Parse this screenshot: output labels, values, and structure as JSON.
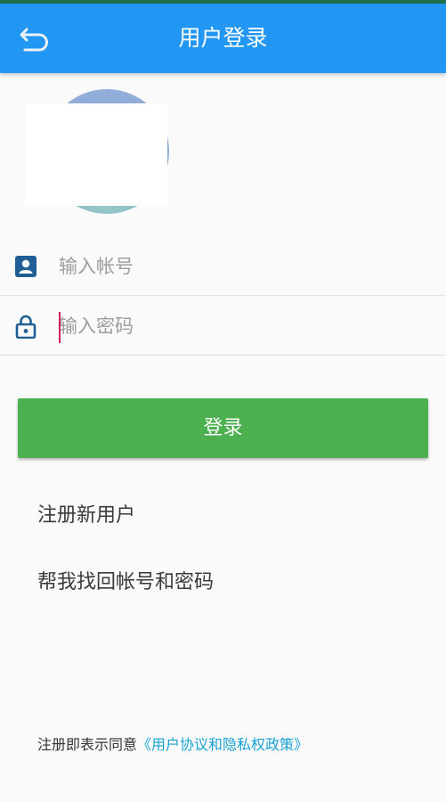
{
  "app_bar": {
    "title": "用户登录",
    "back_icon": "undo-arrow-icon",
    "background": "#2196f3"
  },
  "avatar": {
    "icon": "user-avatar"
  },
  "form": {
    "account": {
      "icon": "contact-card-icon",
      "placeholder": "输入帐号",
      "value": ""
    },
    "password": {
      "icon": "lock-icon",
      "placeholder": "输入密码",
      "value": ""
    },
    "login_label": "登录",
    "login_color": "#4caf50"
  },
  "links": {
    "register": "注册新用户",
    "recover": "帮我找回帐号和密码"
  },
  "agreement": {
    "prefix": "注册即表示同意",
    "link": "《用户协议和隐私权政策》",
    "link_color": "#19a2d4"
  },
  "accent": {
    "icon_color": "#1f5f96",
    "caret_color": "#d81b60"
  }
}
